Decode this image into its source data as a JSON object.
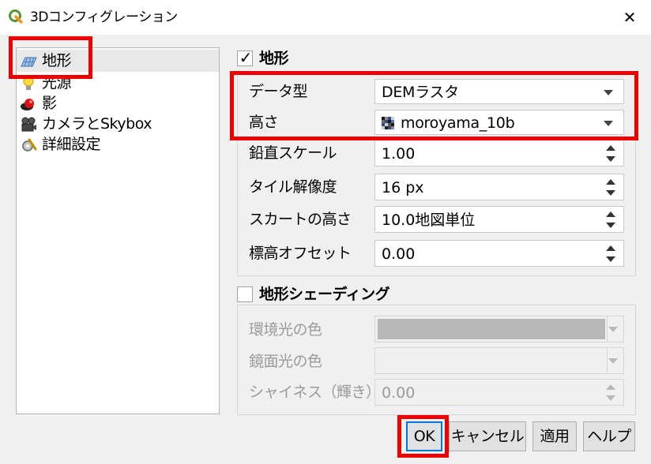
{
  "window": {
    "title": "3Dコンフィグレーション"
  },
  "nav": {
    "items": [
      {
        "label": "地形",
        "icon": "terrain-icon"
      },
      {
        "label": "光源",
        "icon": "light-bulb-icon"
      },
      {
        "label": "影",
        "icon": "shadow-icon"
      },
      {
        "label": "カメラとSkybox",
        "icon": "camera-icon"
      },
      {
        "label": "詳細設定",
        "icon": "advanced-settings-icon"
      }
    ]
  },
  "terrain": {
    "group_title": "地形",
    "checked": true,
    "data_type": {
      "label": "データ型",
      "value": "DEMラスタ"
    },
    "elevation": {
      "label": "高さ",
      "value": "moroyama_10b"
    },
    "vertical_scale": {
      "label": "鉛直スケール",
      "value": "1.00"
    },
    "tile_resolution": {
      "label": "タイル解像度",
      "value": "16 px"
    },
    "skirt_height": {
      "label": "スカートの高さ",
      "value": "10.0地図単位"
    },
    "elevation_offset": {
      "label": "標高オフセット",
      "value": "0.00"
    }
  },
  "shading": {
    "group_title": "地形シェーディング",
    "checked": false,
    "ambient": {
      "label": "環境光の色",
      "color": "#b8b8b8"
    },
    "specular": {
      "label": "鏡面光の色",
      "color": "#f0f0f0"
    },
    "shininess": {
      "label": "シャイネス（輝き）",
      "value": "0.00"
    }
  },
  "buttons": {
    "ok": "OK",
    "cancel": "キャンセル",
    "apply": "適用",
    "help": "ヘルプ"
  },
  "colors": {
    "highlight": "#ee0000",
    "focus": "#0078d7"
  }
}
